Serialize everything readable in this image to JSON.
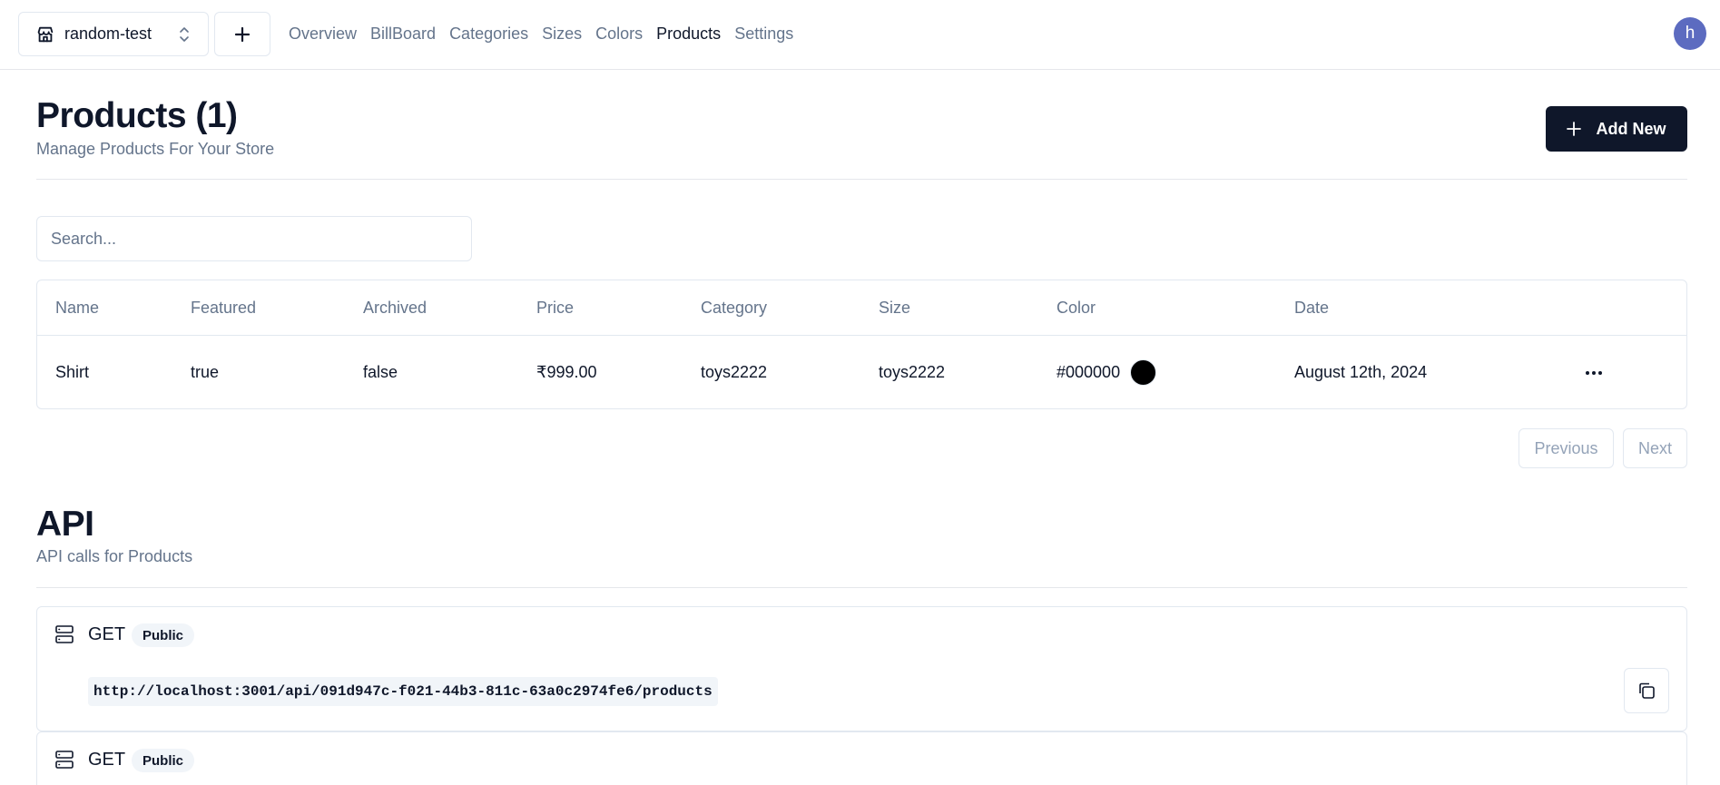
{
  "topbar": {
    "store_name": "random-test",
    "store_icon": "store-icon",
    "nav": [
      {
        "label": "Overview",
        "active": false
      },
      {
        "label": "BillBoard",
        "active": false
      },
      {
        "label": "Categories",
        "active": false
      },
      {
        "label": "Sizes",
        "active": false
      },
      {
        "label": "Colors",
        "active": false
      },
      {
        "label": "Products",
        "active": true
      },
      {
        "label": "Settings",
        "active": false
      }
    ],
    "avatar_initial": "h",
    "avatar_color": "#5c6bc0"
  },
  "header": {
    "title": "Products (1)",
    "description": "Manage Products For Your Store",
    "add_new_label": "Add New"
  },
  "search": {
    "placeholder": "Search...",
    "value": ""
  },
  "table": {
    "columns": [
      "Name",
      "Featured",
      "Archived",
      "Price",
      "Category",
      "Size",
      "Color",
      "Date"
    ],
    "rows": [
      {
        "name": "Shirt",
        "featured": "true",
        "archived": "false",
        "price": "₹999.00",
        "category": "toys2222",
        "size": "toys2222",
        "color": "#000000",
        "date": "August 12th, 2024"
      }
    ]
  },
  "pagination": {
    "previous_label": "Previous",
    "next_label": "Next"
  },
  "api": {
    "title": "API",
    "description": "API calls for Products",
    "endpoints": [
      {
        "method": "GET",
        "badge": "Public",
        "url": "http://localhost:3001/api/091d947c-f021-44b3-811c-63a0c2974fe6/products"
      },
      {
        "method": "GET",
        "badge": "Public",
        "url": ""
      }
    ]
  }
}
